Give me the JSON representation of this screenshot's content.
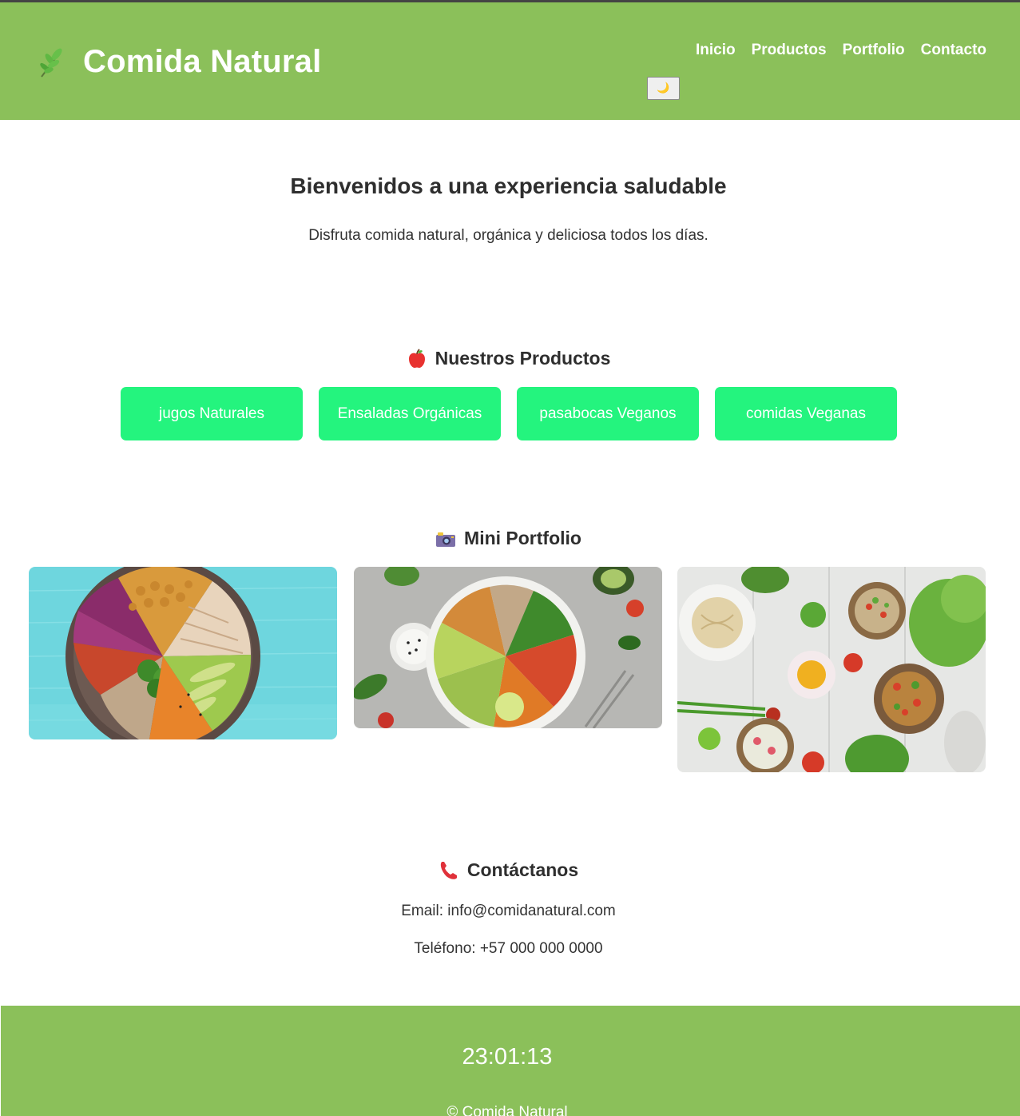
{
  "header": {
    "brand_icon": "herb-icon",
    "brand_title": "Comida Natural",
    "nav": [
      "Inicio",
      "Productos",
      "Portfolio",
      "Contacto"
    ],
    "theme_toggle": "🌙",
    "background_color": "#8bc05a"
  },
  "hero": {
    "title": "Bienvenidos a una experiencia saludable",
    "text": "Disfruta comida natural, orgánica y deliciosa todos los días."
  },
  "products": {
    "icon": "apple-icon",
    "heading": "Nuestros Productos",
    "items": [
      "jugos Naturales",
      "Ensaladas Orgánicas",
      "pasabocas Veganos",
      "comidas Veganas"
    ],
    "card_color": "#24f47e"
  },
  "portfolio": {
    "icon": "camera-icon",
    "heading": "Mini Portfolio",
    "photos": [
      "photo of a buddha bowl with chickpeas, chicken, quinoa, broccoli and avocado on a turquoise wooden table",
      "photo of a bowl with chickpeas, quinoa, spinach, avocado, tomatoes and sweet potato on grey stone",
      "photo of assorted vegetarian dishes, salads and vegetables on a white wooden table"
    ]
  },
  "contact": {
    "icon": "telephone-receiver-icon",
    "heading": "Contáctanos",
    "email": "Email: info@comidanatural.com",
    "phone": "Teléfono: +57 000 000 0000"
  },
  "footer": {
    "clock": "23:01:13",
    "copyright": "© Comida Natural",
    "background_color": "#8bc05a"
  }
}
